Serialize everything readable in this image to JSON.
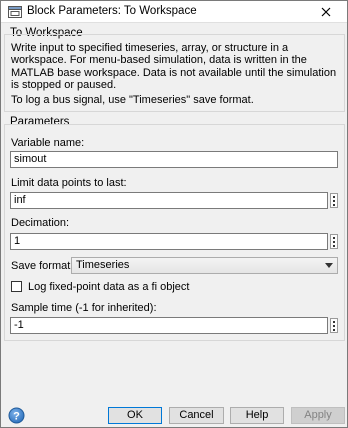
{
  "window": {
    "title": "Block Parameters: To Workspace"
  },
  "block": {
    "name": "To Workspace",
    "description": "Write input to specified timeseries, array, or structure in a workspace. For menu-based simulation, data is written in the MATLAB base workspace. Data is not available until the simulation is stopped or paused.",
    "note": "To log a bus signal, use \"Timeseries\" save format."
  },
  "parameters": {
    "heading": "Parameters",
    "variable_name": {
      "label": "Variable name:",
      "value": "simout"
    },
    "limit_points": {
      "label": "Limit data points to last:",
      "value": "inf"
    },
    "decimation": {
      "label": "Decimation:",
      "value": "1"
    },
    "save_format": {
      "label": "Save format:",
      "value": "Timeseries"
    },
    "log_fixed_point": {
      "label": "Log fixed-point data as a fi object",
      "checked": false
    },
    "sample_time": {
      "label": "Sample time (-1 for inherited):",
      "value": "-1"
    }
  },
  "buttons": {
    "ok": "OK",
    "cancel": "Cancel",
    "help": "Help",
    "apply": "Apply"
  },
  "icons": {
    "app": "simulink-block-icon",
    "close": "close-icon",
    "help": "help-icon",
    "dropdown": "chevron-down-icon"
  },
  "colors": {
    "help_icon": "#2a6ebb",
    "ok_border": "#0078d7"
  }
}
